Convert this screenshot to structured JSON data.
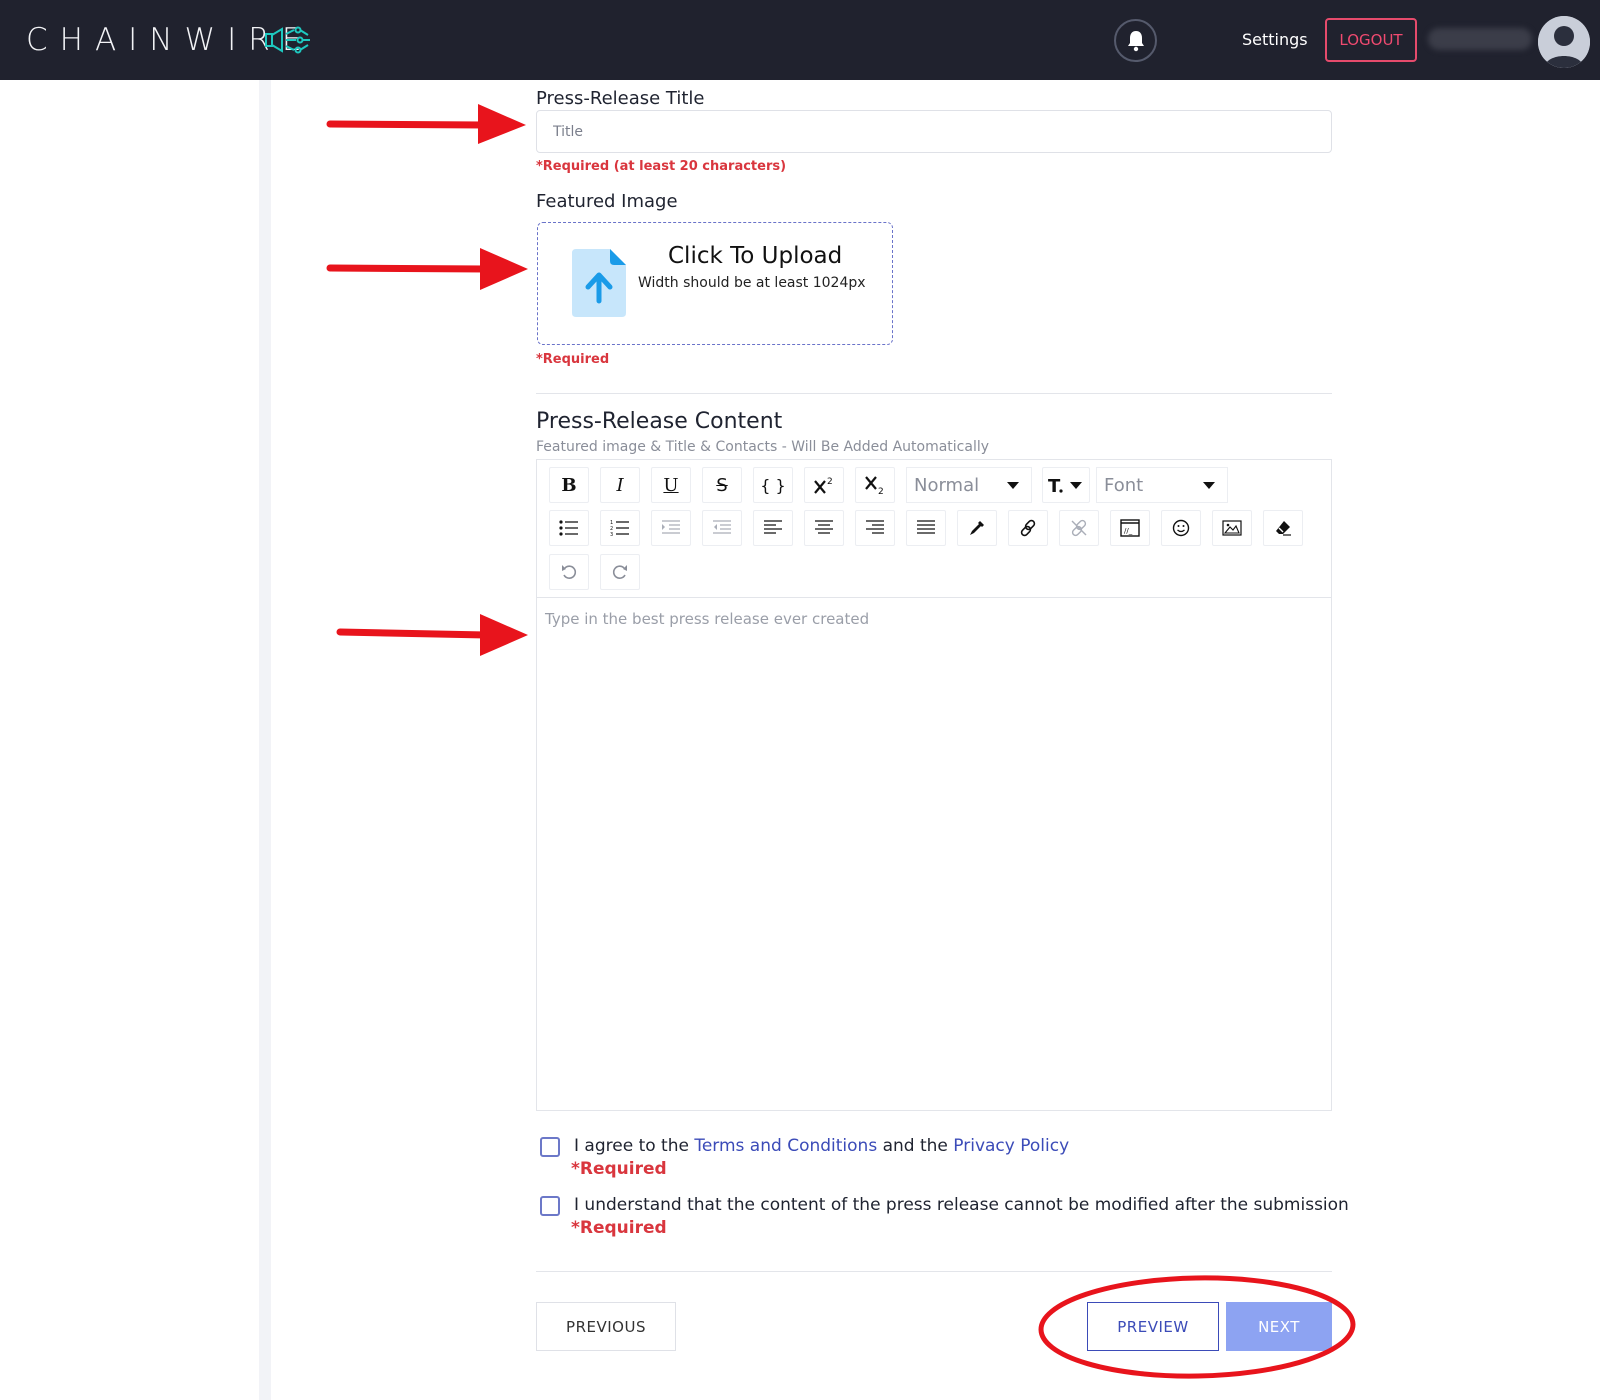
{
  "header": {
    "brand": "CHAINWIRE",
    "settings_label": "Settings",
    "logout_label": "LOGOUT"
  },
  "form": {
    "title_label": "Press-Release Title",
    "title_placeholder": "Title",
    "title_required": "*Required (at least 20 characters)",
    "image_label": "Featured Image",
    "upload_title": "Click To Upload",
    "upload_sub": "Width should be at least 1024px",
    "image_required": "*Required",
    "content_title": "Press-Release Content",
    "content_sub": "Featured image & Title & Contacts - Will Be Added Automatically",
    "toolbar": {
      "bold": "B",
      "italic": "I",
      "underline": "U",
      "strike": "S",
      "code": "{ }",
      "heading_select": "Normal",
      "font_select": "Font"
    },
    "editor_placeholder": "Type in the best press release ever created",
    "agree_prefix": "I agree to the ",
    "terms_link": "Terms and Conditions",
    "agree_mid": " and the ",
    "privacy_link": "Privacy Policy",
    "agree_required": "*Required",
    "understand_label": "I understand that the content of the press release cannot be modified after the submission",
    "understand_required": "*Required",
    "previous_button": "PREVIOUS",
    "preview_button": "PREVIEW",
    "next_button": "NEXT"
  },
  "colors": {
    "header_bg": "#20222e",
    "brand_accent": "#1ec9c0",
    "logout": "#f04a70",
    "required": "#d9363e",
    "link": "#3b4bb8",
    "next_bg": "#8da3f2",
    "annotation": "#e8141c"
  }
}
